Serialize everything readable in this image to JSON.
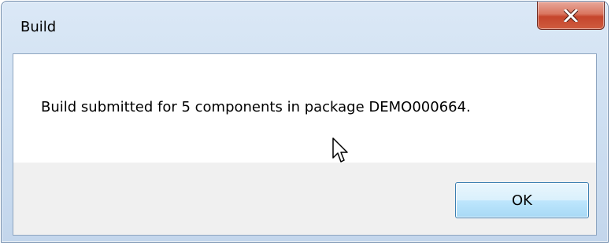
{
  "window": {
    "title": "Build",
    "close_icon": "close-x-icon",
    "accent_close": "#c5452c"
  },
  "dialog": {
    "message": "Build submitted for 5 components in package DEMO000664.",
    "ok_label": "OK"
  },
  "cursor": {
    "icon": "arrow-pointer-icon"
  }
}
